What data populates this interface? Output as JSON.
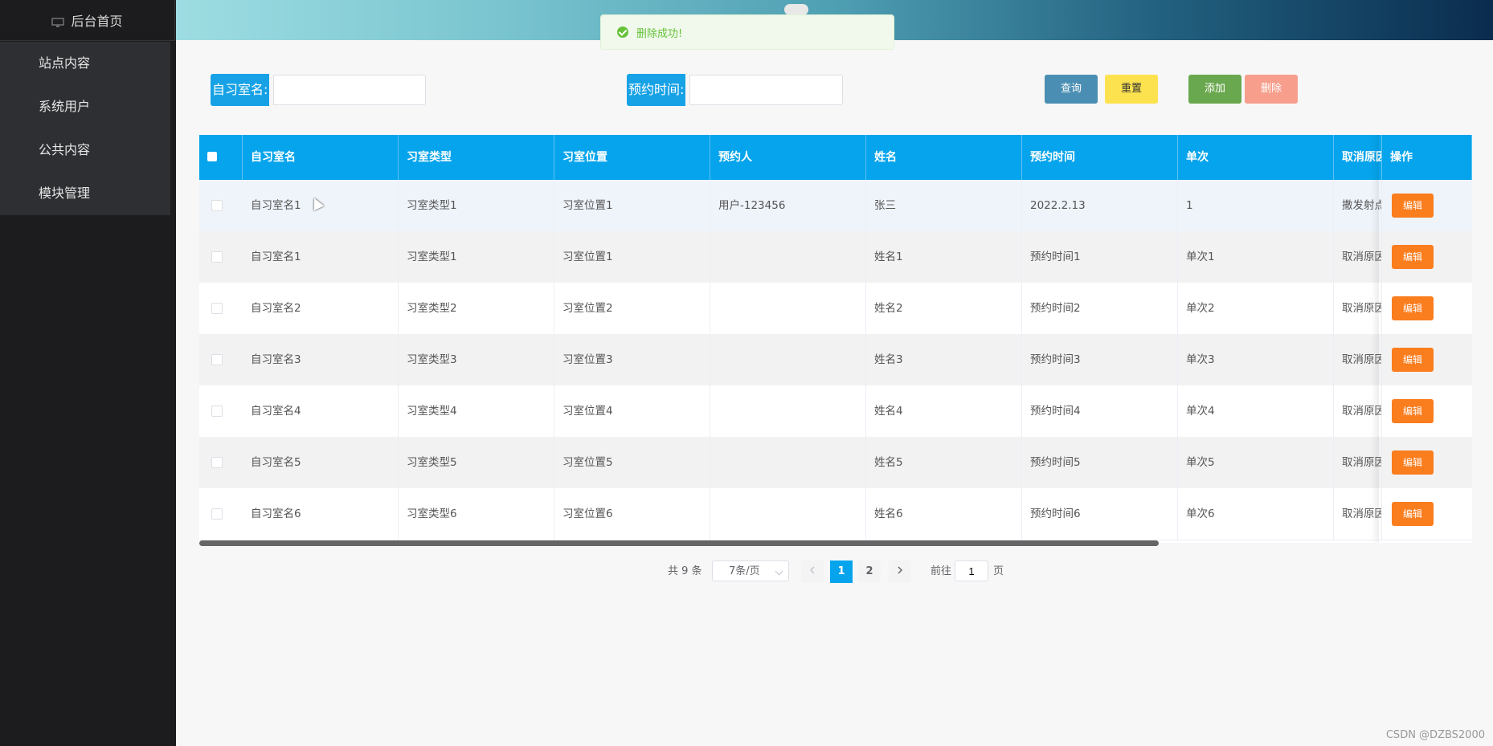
{
  "sidebar": {
    "title": "后台首页",
    "items": [
      {
        "label": "站点内容"
      },
      {
        "label": "系统用户"
      },
      {
        "label": "公共内容"
      },
      {
        "label": "模块管理"
      }
    ]
  },
  "toast": {
    "message": "删除成功!"
  },
  "search": {
    "name_label": "自习室名:",
    "time_label": "预约时间:",
    "name_value": "",
    "time_value": ""
  },
  "buttons": {
    "query": "查询",
    "reset": "重置",
    "add": "添加",
    "delete": "删除"
  },
  "colors": {
    "primary": "#06a4ec",
    "query": "#4a8fb3",
    "reset": "#fde24f",
    "add": "#6aa84f",
    "delete": "#f79e8c",
    "edit": "#fa7d1e",
    "sidebar": "#1c1c1e"
  },
  "table": {
    "headers": [
      "自习室名",
      "习室类型",
      "习室位置",
      "预约人",
      "姓名",
      "预约时间",
      "单次",
      "取消原因",
      "操作"
    ],
    "edit_label": "编辑",
    "rows": [
      [
        "自习室名1",
        "习室类型1",
        "习室位置1",
        "用户-123456",
        "张三",
        "2022.2.13",
        "1",
        "撒发射点"
      ],
      [
        "自习室名1",
        "习室类型1",
        "习室位置1",
        "",
        "姓名1",
        "预约时间1",
        "单次1",
        "取消原因"
      ],
      [
        "自习室名2",
        "习室类型2",
        "习室位置2",
        "",
        "姓名2",
        "预约时间2",
        "单次2",
        "取消原因"
      ],
      [
        "自习室名3",
        "习室类型3",
        "习室位置3",
        "",
        "姓名3",
        "预约时间3",
        "单次3",
        "取消原因"
      ],
      [
        "自习室名4",
        "习室类型4",
        "习室位置4",
        "",
        "姓名4",
        "预约时间4",
        "单次4",
        "取消原因"
      ],
      [
        "自习室名5",
        "习室类型5",
        "习室位置5",
        "",
        "姓名5",
        "预约时间5",
        "单次5",
        "取消原因"
      ],
      [
        "自习室名6",
        "习室类型6",
        "习室位置6",
        "",
        "姓名6",
        "预约时间6",
        "单次6",
        "取消原因"
      ]
    ]
  },
  "pagination": {
    "total": "共 9 条",
    "page_size": "7条/页",
    "pages": [
      "1",
      "2"
    ],
    "current": "1",
    "goto_prefix": "前往",
    "goto_value": "1",
    "goto_suffix": "页"
  },
  "watermark": "CSDN @DZBS2000"
}
